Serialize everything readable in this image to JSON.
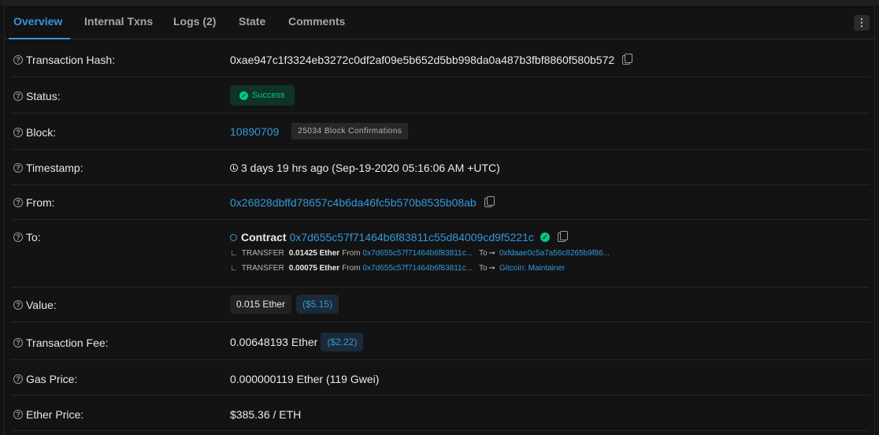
{
  "tabs": [
    {
      "label": "Overview",
      "active": true
    },
    {
      "label": "Internal Txns",
      "active": false
    },
    {
      "label": "Logs (2)",
      "active": false
    },
    {
      "label": "State",
      "active": false
    },
    {
      "label": "Comments",
      "active": false
    }
  ],
  "rows": {
    "tx_hash": {
      "label": "Transaction Hash:",
      "value": "0xae947c1f3324eb3272c0df2af09e5b652d5bb998da0a487b3fbf8860f580b572"
    },
    "status": {
      "label": "Status:",
      "value": "Success"
    },
    "block": {
      "label": "Block:",
      "value": "10890709",
      "confirmations": "25034 Block Confirmations"
    },
    "timestamp": {
      "label": "Timestamp:",
      "value": "3 days 19 hrs ago (Sep-19-2020 05:16:06 AM +UTC)"
    },
    "from": {
      "label": "From:",
      "value": "0x26828dbffd78657c4b6da46fc5b570b8535b08ab"
    },
    "to": {
      "label": "To:",
      "contract_prefix": "Contract",
      "value": "0x7d655c57f71464b6f83811c55d84009cd9f5221c",
      "transfers": [
        {
          "kind": "TRANSFER",
          "amount": "0.01425 Ether",
          "from_label": "From",
          "from": "0x7d655c57f71464b6f83811c...",
          "to_label": "To",
          "to": "0xfdaae0c5a7a56c8265b9f86..."
        },
        {
          "kind": "TRANSFER",
          "amount": "0.00075 Ether",
          "from_label": "From",
          "from": "0x7d655c57f71464b6f83811c...",
          "to_label": "To",
          "to": "Gitcoin: Maintainer"
        }
      ]
    },
    "value": {
      "label": "Value:",
      "value": "0.015 Ether",
      "usd": "($5.15)"
    },
    "fee": {
      "label": "Transaction Fee:",
      "value": "0.00648193 Ether",
      "usd": "($2.22)"
    },
    "gas_price": {
      "label": "Gas Price:",
      "value": "0.000000119 Ether (119 Gwei)"
    },
    "ether_price": {
      "label": "Ether Price:",
      "value": "$385.36 / ETH"
    }
  },
  "colors": {
    "accent": "#3498db",
    "success": "#00c98a",
    "background": "#131313"
  }
}
